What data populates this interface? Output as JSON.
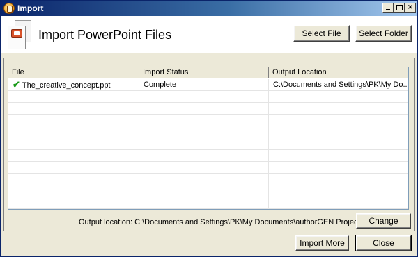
{
  "window": {
    "title": "Import",
    "controls": {
      "minimize": "_",
      "maximize": "□",
      "close": "×"
    }
  },
  "header": {
    "title": "Import PowerPoint Files",
    "select_file_label": "Select File",
    "select_folder_label": "Select Folder",
    "icon": "powerpoint-document-icon"
  },
  "grid": {
    "columns": [
      "File",
      "Import Status",
      "Output Location"
    ],
    "rows": [
      {
        "file": "The_creative_concept.ppt",
        "status": "Complete",
        "output": "C:\\Documents and Settings\\PK\\My Do...",
        "status_icon": "check-icon"
      }
    ]
  },
  "footer": {
    "output_location_text": "Output location: C:\\Documents and Settings\\PK\\My Documents\\authorGEN Projects",
    "change_label": "Change",
    "import_more_label": "Import More",
    "close_label": "Close"
  },
  "colors": {
    "titlebar_start": "#0a246a",
    "titlebar_end": "#a6caf0",
    "check_green": "#1a9a1a",
    "face": "#ece9d8"
  }
}
